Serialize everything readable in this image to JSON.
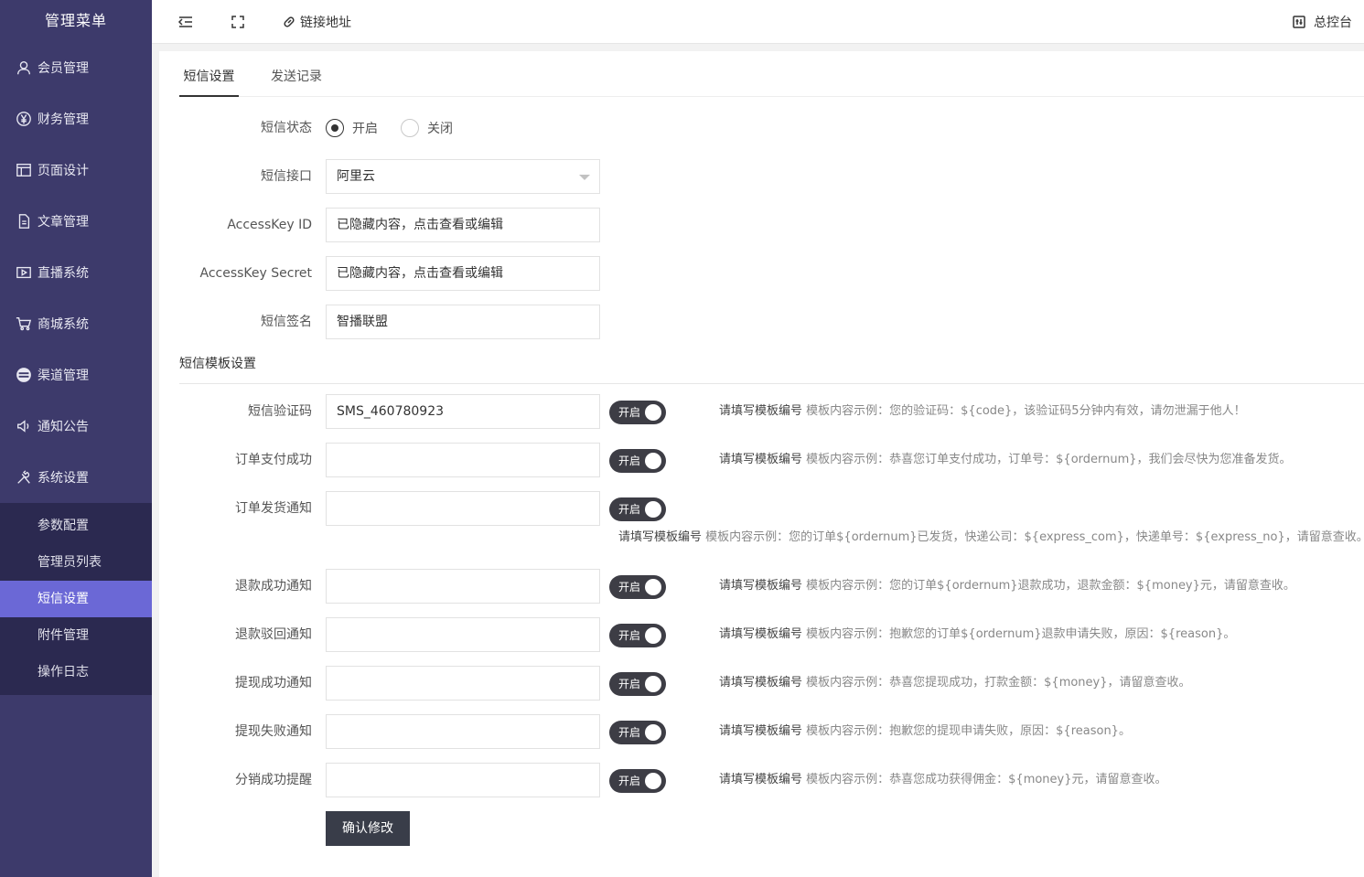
{
  "sidebar": {
    "title": "管理菜单",
    "items": [
      {
        "label": "会员管理",
        "icon": "user-icon"
      },
      {
        "label": "财务管理",
        "icon": "yen-icon"
      },
      {
        "label": "页面设计",
        "icon": "layout-icon"
      },
      {
        "label": "文章管理",
        "icon": "document-icon"
      },
      {
        "label": "直播系统",
        "icon": "video-icon"
      },
      {
        "label": "商城系统",
        "icon": "cart-icon"
      },
      {
        "label": "渠道管理",
        "icon": "stack-icon"
      },
      {
        "label": "通知公告",
        "icon": "speaker-icon"
      },
      {
        "label": "系统设置",
        "icon": "tools-icon"
      }
    ],
    "sub_items": [
      {
        "label": "参数配置"
      },
      {
        "label": "管理员列表"
      },
      {
        "label": "短信设置",
        "active": true
      },
      {
        "label": "附件管理"
      },
      {
        "label": "操作日志"
      }
    ]
  },
  "topbar": {
    "link_label": "链接地址",
    "console_label": "总控台"
  },
  "tabs": [
    {
      "label": "短信设置",
      "active": true
    },
    {
      "label": "发送记录",
      "active": false
    }
  ],
  "form": {
    "status_label": "短信状态",
    "status_on": "开启",
    "status_off": "关闭",
    "status_value": "开启",
    "api_label": "短信接口",
    "api_value": "阿里云",
    "key_id_label": "AccessKey ID",
    "key_id_placeholder": "已隐藏内容，点击查看或编辑",
    "key_secret_label": "AccessKey Secret",
    "key_secret_placeholder": "已隐藏内容，点击查看或编辑",
    "sign_label": "短信签名",
    "sign_value": "智播联盟"
  },
  "template_section_title": "短信模板设置",
  "templates": [
    {
      "label": "短信验证码",
      "value": "SMS_460780923",
      "switch": "开启",
      "hint_strong": "请填写模板编号",
      "hint": " 模板内容示例：您的验证码：${code}，该验证码5分钟内有效，请勿泄漏于他人！"
    },
    {
      "label": "订单支付成功",
      "value": "",
      "switch": "开启",
      "hint_strong": "请填写模板编号",
      "hint": " 模板内容示例：恭喜您订单支付成功，订单号：${ordernum}，我们会尽快为您准备发货。"
    },
    {
      "label": "订单发货通知",
      "value": "",
      "switch": "开启",
      "hint_strong": "请填写模板编号",
      "hint": " 模板内容示例：您的订单${ordernum}已发货，快递公司：${express_com}，快递单号：${express_no}，请留意查收。"
    },
    {
      "label": "退款成功通知",
      "value": "",
      "switch": "开启",
      "hint_strong": "请填写模板编号",
      "hint": " 模板内容示例：您的订单${ordernum}退款成功，退款金额：${money}元，请留意查收。"
    },
    {
      "label": "退款驳回通知",
      "value": "",
      "switch": "开启",
      "hint_strong": "请填写模板编号",
      "hint": " 模板内容示例：抱歉您的订单${ordernum}退款申请失败，原因：${reason}。"
    },
    {
      "label": "提现成功通知",
      "value": "",
      "switch": "开启",
      "hint_strong": "请填写模板编号",
      "hint": " 模板内容示例：恭喜您提现成功，打款金额：${money}，请留意查收。"
    },
    {
      "label": "提现失败通知",
      "value": "",
      "switch": "开启",
      "hint_strong": "请填写模板编号",
      "hint": " 模板内容示例：抱歉您的提现申请失败，原因：${reason}。"
    },
    {
      "label": "分销成功提醒",
      "value": "",
      "switch": "开启",
      "hint_strong": "请填写模板编号",
      "hint": " 模板内容示例：恭喜您成功获得佣金：${money}元，请留意查收。"
    }
  ],
  "submit_label": "确认修改"
}
